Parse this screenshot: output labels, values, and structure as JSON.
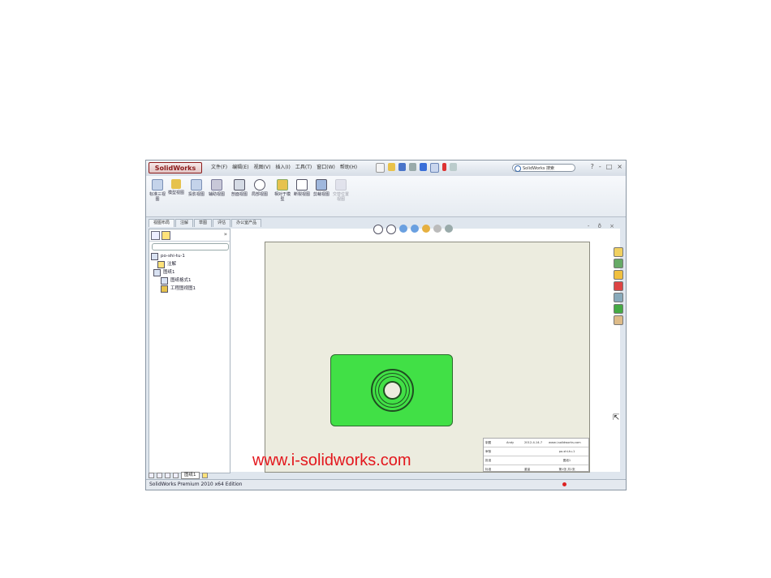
{
  "app": {
    "logo_text": "SolidWorks",
    "menus": [
      "文件(F)",
      "编辑(E)",
      "视图(V)",
      "插入(I)",
      "工具(T)",
      "窗口(W)",
      "帮助(H)"
    ],
    "search_placeholder": "SolidWorks 搜索",
    "window_buttons": [
      "?",
      "-",
      "□",
      "×"
    ]
  },
  "ribbon": {
    "tools": [
      {
        "label": "标准三视图",
        "icon": "standard-3-view-icon"
      },
      {
        "label": "模型视图",
        "icon": "model-view-icon"
      },
      {
        "label": "投影视图",
        "icon": "projected-view-icon"
      },
      {
        "label": "辅助视图",
        "icon": "auxiliary-view-icon"
      },
      {
        "label": "剖面视图",
        "icon": "section-view-icon"
      },
      {
        "label": "局部视图",
        "icon": "detail-view-icon"
      },
      {
        "label": "相对于模型",
        "icon": "relative-view-icon"
      },
      {
        "label": "断裂视图",
        "icon": "broken-view-icon"
      },
      {
        "label": "剪裁视图",
        "icon": "crop-view-icon"
      },
      {
        "label": "交替位置视图",
        "icon": "alternate-position-icon"
      }
    ],
    "tabs": [
      "视图布局",
      "注解",
      "草图",
      "评估",
      "办公室产品"
    ]
  },
  "tree": {
    "root": "po-shi-tu-1",
    "items": [
      "注解",
      "图纸1",
      "图纸格式1",
      "工程图视图1"
    ]
  },
  "graphics": {
    "window_controls": "- ð ×",
    "title_block": {
      "rows": [
        [
          "制图",
          "Andy",
          "2012-4-14-7",
          "www.i-solidworks.com"
        ],
        [
          "审核",
          "",
          "",
          "po-shi-tu-1"
        ],
        [
          "批准",
          "",
          "",
          "图纸1"
        ],
        [
          "标准",
          "",
          "重量",
          "第1张 共1张"
        ]
      ]
    }
  },
  "watermark": "www.i-solidworks.com",
  "sheet_tabs": [
    "图纸1"
  ],
  "status": {
    "text": "SolidWorks Premium 2010 x64 Edition"
  },
  "colors": {
    "part": "#41e046",
    "watermark": "#e3171d",
    "sheet": "#ececdf"
  }
}
